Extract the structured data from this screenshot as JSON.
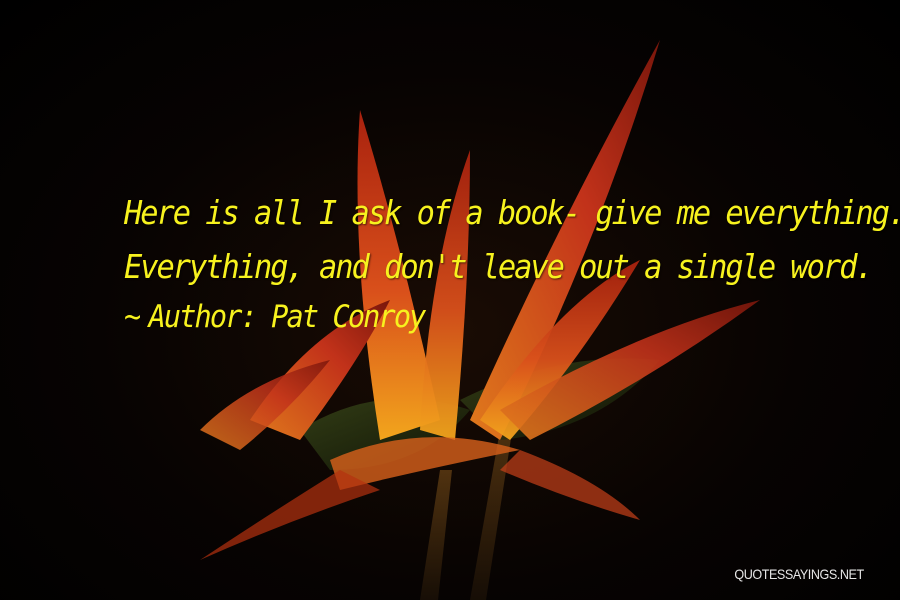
{
  "quote": {
    "lines": [
      "Here is all I ask of a book- give me everything.",
      "Everything, and don't leave out a single word."
    ],
    "author_prefix": "~",
    "author_label": "Author: Pat Conroy"
  },
  "watermark": "QUOTESSAYINGS.NET",
  "colors": {
    "text": "#f7f21e",
    "background": "#000000",
    "petal_orange": "#d8451a",
    "petal_yellow": "#f0a520"
  }
}
